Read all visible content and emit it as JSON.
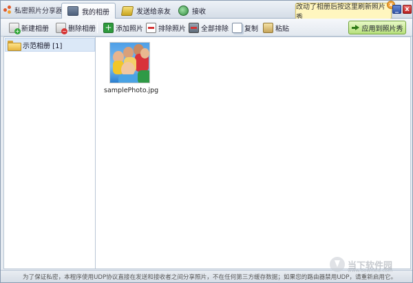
{
  "app": {
    "title": "私密照片分享器"
  },
  "tabs": [
    {
      "label": "我的相册",
      "icon": "album-icon",
      "active": true
    },
    {
      "label": "发送给亲友",
      "icon": "send-icon",
      "active": false
    },
    {
      "label": "接收",
      "icon": "receive-icon",
      "active": false
    }
  ],
  "tooltip": {
    "text": "改动了相册后按这里刷新照片秀",
    "close": "x"
  },
  "window_buttons": {
    "minimize": "_",
    "close": "x"
  },
  "toolbar": {
    "new_album": "新建相册",
    "delete_album": "删除相册",
    "add_photo": "添加照片",
    "remove_photo": "排除照片",
    "remove_all": "全部排除",
    "copy": "复制",
    "paste": "粘贴",
    "apply": "应用到照片秀"
  },
  "sidebar": {
    "items": [
      {
        "label": "示范相册 [1]",
        "selected": true
      }
    ]
  },
  "photos": [
    {
      "name": "samplePhoto.jpg"
    }
  ],
  "status": {
    "text": "为了保证私密，本程序使用UDP协议直接在发送和接收者之间分享照片，不在任何第三方缓存数据；如果您的路由器禁用UDP，请重新启用它。"
  },
  "watermark": {
    "text": "当下软件园",
    "sub": "www.downxia.com"
  },
  "colors": {
    "accent": "#b7e07c",
    "selection": "#dbe8f7",
    "tooltip": "#fff6bf"
  }
}
